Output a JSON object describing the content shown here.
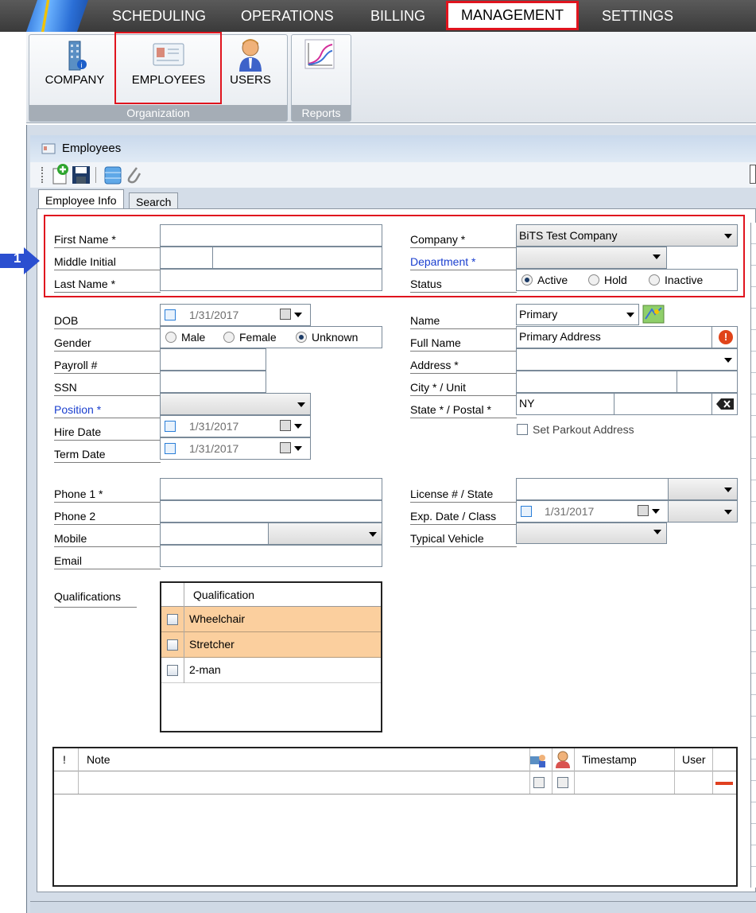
{
  "menu": {
    "items": [
      "SCHEDULING",
      "OPERATIONS",
      "BILLING",
      "MANAGEMENT",
      "SETTINGS"
    ]
  },
  "ribbon": {
    "organization_group": "Organization",
    "reports_group": "Reports",
    "company": "COMPANY",
    "employees": "EMPLOYEES",
    "users": "USERS"
  },
  "window": {
    "title": "Employees"
  },
  "tabs": {
    "employee_info": "Employee Info",
    "search": "Search"
  },
  "callout": "1",
  "form": {
    "first_name": "First Name *",
    "middle_initial": "Middle Initial",
    "last_name": "Last Name *",
    "company": "Company *",
    "company_value": "BiTS Test Company",
    "department": "Department *",
    "status": "Status",
    "status_active": "Active",
    "status_hold": "Hold",
    "status_inactive": "Inactive",
    "dob": "DOB",
    "gender": "Gender",
    "gender_male": "Male",
    "gender_female": "Female",
    "gender_unknown": "Unknown",
    "payroll": "Payroll #",
    "ssn": "SSN",
    "position": "Position *",
    "hire_date": "Hire Date",
    "term_date": "Term Date",
    "date_value": "1/31/2017",
    "name": "Name",
    "name_value": "Primary",
    "full_name": "Full Name",
    "full_name_value": "Primary Address",
    "address": "Address *",
    "city_unit": "City * / Unit",
    "state_postal": "State * / Postal *",
    "state_value": "NY",
    "set_parkout": "Set Parkout Address",
    "phone1": "Phone 1 *",
    "phone2": "Phone 2",
    "mobile": "Mobile",
    "email": "Email",
    "license_state": "License # / State",
    "exp_class": "Exp. Date / Class",
    "typical_vehicle": "Typical Vehicle",
    "qualifications": "Qualifications"
  },
  "qualifications_table": {
    "header": "Qualification",
    "rows": [
      "Wheelchair",
      "Stretcher",
      "2-man"
    ]
  },
  "notes_table": {
    "bang": "!",
    "note": "Note",
    "timestamp": "Timestamp",
    "user": "User"
  },
  "colors": {
    "highlight": "#e0141e",
    "row_selected": "#fbcf9e",
    "required_blue": "#1a3fcf"
  }
}
